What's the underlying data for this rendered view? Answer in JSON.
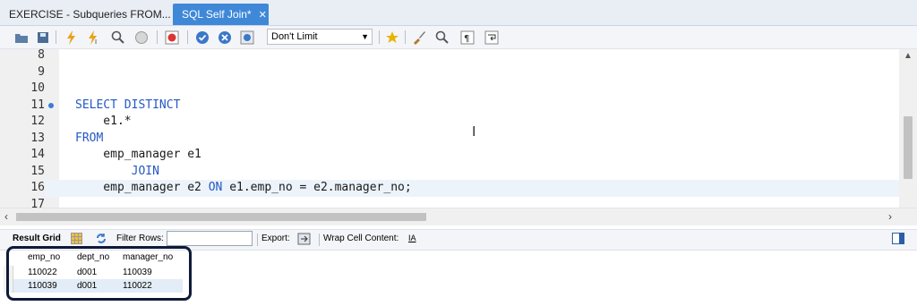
{
  "tabs": [
    {
      "label": "EXERCISE - Subqueries FROM...",
      "active": false
    },
    {
      "label": "SQL Self Join*",
      "active": true,
      "close": "✕"
    }
  ],
  "toolbar": {
    "limit_value": "Don't Limit",
    "icons": [
      "folder-open-icon",
      "save-icon",
      "execute-icon",
      "execute-current-icon",
      "explain-icon",
      "stop-icon",
      "toggle-stop-on-error-icon",
      "commit-icon",
      "rollback-icon",
      "autocommit-icon",
      "beautify-icon",
      "find-icon",
      "invisible-chars-icon",
      "wrap-icon"
    ]
  },
  "editor": {
    "lines": [
      {
        "num": "8",
        "code": ""
      },
      {
        "num": "9",
        "code": ""
      },
      {
        "num": "10",
        "code": ""
      },
      {
        "num": "11",
        "kw": "SELECT DISTINCT",
        "rest": "",
        "marker": true
      },
      {
        "num": "12",
        "code": "    e1.*"
      },
      {
        "num": "13",
        "kw": "FROM",
        "rest": ""
      },
      {
        "num": "14",
        "code": "    emp_manager e1"
      },
      {
        "num": "15",
        "indent": "        ",
        "kw": "JOIN",
        "rest": ""
      },
      {
        "num": "16",
        "pre": "    emp_manager e2 ",
        "kw": "ON",
        "rest": " e1.emp_no = e2.manager_no;",
        "current": true
      },
      {
        "num": "17",
        "code": ""
      }
    ]
  },
  "result_toolbar": {
    "result_grid": "Result Grid",
    "filter_rows": "Filter Rows:",
    "export": "Export:",
    "wrap_cell": "Wrap Cell Content:",
    "wrap_icon": "IA"
  },
  "result": {
    "columns": [
      "emp_no",
      "dept_no",
      "manager_no"
    ],
    "rows": [
      [
        "110022",
        "d001",
        "110039"
      ],
      [
        "110039",
        "d001",
        "110022"
      ]
    ]
  }
}
